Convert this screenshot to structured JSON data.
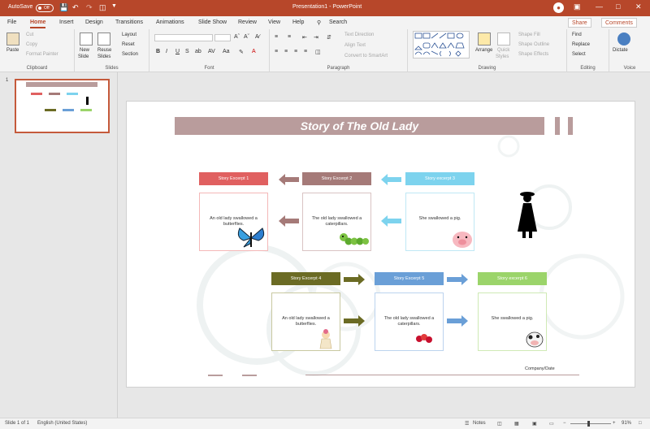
{
  "titlebar": {
    "autosave_label": "AutoSave",
    "autosave_state": "Off",
    "doc_title": "Presentation1 - PowerPoint"
  },
  "tabs": [
    "File",
    "Home",
    "Insert",
    "Design",
    "Transitions",
    "Animations",
    "Slide Show",
    "Review",
    "View",
    "Help"
  ],
  "search_label": "Search",
  "share_label": "Share",
  "comments_label": "Comments",
  "ribbon": {
    "clipboard": {
      "paste": "Paste",
      "cut": "Cut",
      "copy": "Copy",
      "format_painter": "Format Painter",
      "label": "Clipboard"
    },
    "slides": {
      "new_slide_1": "New",
      "new_slide_2": "Slide",
      "reuse_1": "Reuse",
      "reuse_2": "Slides",
      "layout": "Layout",
      "reset": "Reset",
      "section": "Section",
      "label": "Slides"
    },
    "font": {
      "label": "Font"
    },
    "paragraph": {
      "text_direction": "Text Direction",
      "align_text": "Align Text",
      "smartart": "Convert to SmartArt",
      "label": "Paragraph"
    },
    "drawing": {
      "arrange": "Arrange",
      "quick_1": "Quick",
      "quick_2": "Styles",
      "shape_fill": "Shape Fill",
      "shape_outline": "Shape Outline",
      "shape_effects": "Shape Effects",
      "label": "Drawing"
    },
    "editing": {
      "find": "Find",
      "replace": "Replace",
      "select": "Select",
      "label": "Editing"
    },
    "voice": {
      "dictate": "Dictate",
      "label": "Voice"
    }
  },
  "slide_number": "1",
  "slide": {
    "title": "Story of The Old Lady",
    "footer": "Company/Date",
    "row1": [
      {
        "header": "Story Excerpt 1",
        "text": "An old lady swallowed a butterflies.",
        "color": "#e06060"
      },
      {
        "header": "Story Excerpt 2",
        "text": "The old lady swallowed a caterpillars.",
        "color": "#a57a78"
      },
      {
        "header": "Story excerpt 3",
        "text": "She swallowed a pig.",
        "color": "#7dd3ee"
      }
    ],
    "row2": [
      {
        "header": "Story Excerpt 4",
        "text": "An old lady swallowed a butterflies.",
        "color": "#6b6b24"
      },
      {
        "header": "Story Excerpt 5",
        "text": "The old lady swallowed a caterpillars.",
        "color": "#6a9fd7"
      },
      {
        "header": "Story excerpt 6",
        "text": "She swallowed a pig.",
        "color": "#9bd46a"
      }
    ]
  },
  "status": {
    "slide_of": "Slide 1 of 1",
    "language": "English (United States)",
    "notes": "Notes",
    "zoom": "91%"
  }
}
